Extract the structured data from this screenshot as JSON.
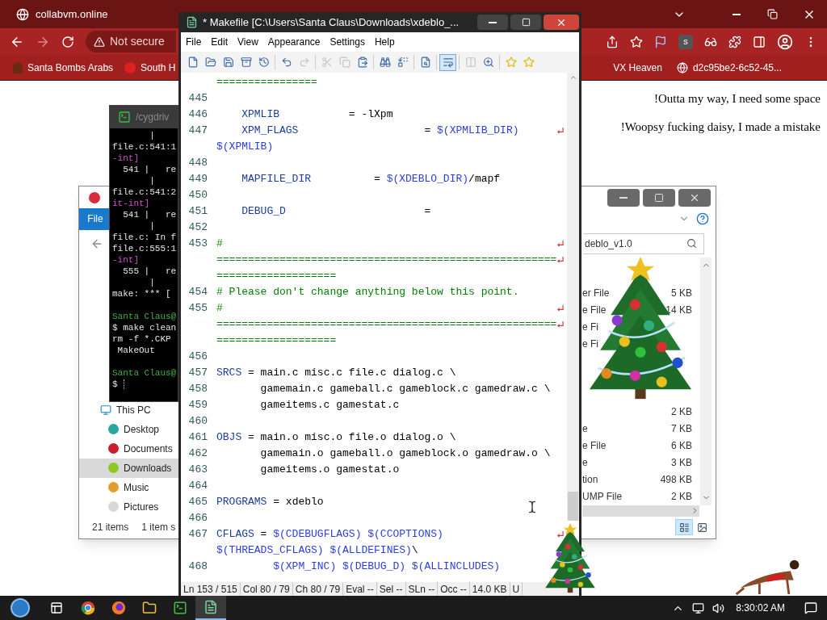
{
  "browser": {
    "tab_title": "collabvm.online",
    "security_label": "Not secure",
    "extension_letter": "s",
    "bookmarks_left": [
      {
        "label": "Santa Bombs Arabs"
      },
      {
        "label": "South H"
      }
    ],
    "bookmarks_right": [
      {
        "label": "VX Heaven"
      },
      {
        "label": "d2c95be2-6c52-45..."
      }
    ]
  },
  "chat": [
    "!Outta my way, I need some space",
    "!Woopsy fucking daisy, I made a mistake"
  ],
  "terminal": {
    "title": "/cygdriv",
    "lines": [
      {
        "kind": "plain",
        "text": "       |"
      },
      {
        "kind": "plain",
        "text": "file.c:541:1"
      },
      {
        "kind": "warn",
        "text": "-int]"
      },
      {
        "kind": "plain",
        "text": "  541 |   re"
      },
      {
        "kind": "plain",
        "text": "       |"
      },
      {
        "kind": "plain",
        "text": "file.c:541:2"
      },
      {
        "kind": "warn",
        "text": "it-int]"
      },
      {
        "kind": "plain",
        "text": "  541 |   re"
      },
      {
        "kind": "plain",
        "text": "       |"
      },
      {
        "kind": "plain",
        "text": "file.c: In f"
      },
      {
        "kind": "plain",
        "text": "file.c:555:1"
      },
      {
        "kind": "warn",
        "text": "-int]"
      },
      {
        "kind": "plain",
        "text": "  555 |   re"
      },
      {
        "kind": "plain",
        "text": "       |"
      },
      {
        "kind": "plain",
        "text": "make: *** ["
      },
      {
        "kind": "blank"
      },
      {
        "kind": "prompt",
        "text": "Santa Claus@"
      },
      {
        "kind": "plain",
        "text": "$ make clean"
      },
      {
        "kind": "plain",
        "text": "rm -f *.CKP"
      },
      {
        "kind": "plain",
        "text": " MakeOut"
      },
      {
        "kind": "blank"
      },
      {
        "kind": "prompt",
        "text": "Santa Claus@"
      },
      {
        "kind": "input",
        "text": "$"
      }
    ]
  },
  "explorer": {
    "ribbon_tab": "File",
    "search_value": "deblo_v1.0",
    "nav": [
      {
        "label": "This PC",
        "selected": false,
        "children": [
          {
            "label": "Desktop",
            "selected": false,
            "color": "#2aa6a0"
          },
          {
            "label": "Documents",
            "selected": false,
            "color": "#c8202a"
          },
          {
            "label": "Downloads",
            "selected": true,
            "color": "#8cc820"
          },
          {
            "label": "Music",
            "selected": false,
            "color": "#e0a030"
          },
          {
            "label": "Pictures",
            "selected": false,
            "color": "#d8d8d8"
          }
        ]
      }
    ],
    "files_upper": [
      {
        "type": "er File",
        "size": "5 KB"
      },
      {
        "type": "e File",
        "size": "14 KB"
      },
      {
        "type": "e Fi"
      },
      {
        "type": "e Fi"
      }
    ],
    "files_lower": [
      {
        "size": "2 KB"
      },
      {
        "type": "e",
        "size": "7 KB"
      },
      {
        "type": "e File",
        "size": "6 KB"
      },
      {
        "type": "e",
        "size": "3 KB"
      },
      {
        "type": "tion",
        "size": "498 KB"
      },
      {
        "type": "UMP File",
        "size": "2 KB"
      }
    ],
    "status_count": "21 items",
    "status_selection": "1 item s",
    "details_view": true
  },
  "editor": {
    "title": "* Makefile [C:\\Users\\Santa Claus\\Downloads\\xdeblo_...",
    "menu": [
      "File",
      "Edit",
      "View",
      "Appearance",
      "Settings",
      "Help"
    ],
    "toolbar": [
      {
        "disabled": false,
        "selected": false
      },
      {
        "disabled": false,
        "selected": false
      },
      {
        "disabled": false,
        "selected": false
      },
      {
        "disabled": false,
        "selected": false
      },
      {
        "disabled": false,
        "selected": false
      },
      {
        "disabled": false,
        "selected": false
      },
      {
        "disabled": true,
        "selected": false
      },
      {
        "disabled": true,
        "selected": false
      },
      {
        "disabled": true,
        "selected": false
      },
      {
        "disabled": false,
        "selected": false
      },
      {
        "disabled": false,
        "selected": false
      },
      {
        "disabled": false,
        "selected": false
      },
      {
        "disabled": false,
        "selected": false
      },
      {
        "disabled": false,
        "selected": true
      },
      {
        "disabled": true,
        "selected": false
      },
      {
        "disabled": false,
        "selected": false
      },
      {
        "disabled": false,
        "selected": false
      },
      {
        "disabled": false,
        "selected": false
      }
    ],
    "rows": [
      {
        "wrap": false,
        "seg": [
          {
            "text": "================",
            "kind": "comment"
          }
        ]
      },
      {
        "n": "445",
        "wrap": false
      },
      {
        "n": "446",
        "wrap": false,
        "seg": [
          {
            "text": "    XPMLIB",
            "kind": "name"
          },
          {
            "text": "           = -lXpm",
            "kind": "plain"
          }
        ]
      },
      {
        "n": "447",
        "wrap": true,
        "seg": [
          {
            "text": "    XPM_FLAGS",
            "kind": "name"
          },
          {
            "text": "                    = ",
            "kind": "plain"
          },
          {
            "text": "$(XPMLIB_DIR)",
            "kind": "macro"
          }
        ]
      },
      {
        "wrap": false,
        "seg": [
          {
            "text": "$(XPMLIB)",
            "kind": "macro"
          }
        ]
      },
      {
        "n": "448",
        "wrap": false
      },
      {
        "n": "449",
        "wrap": false,
        "seg": [
          {
            "text": "    MAPFILE_DIR",
            "kind": "name"
          },
          {
            "text": "          = ",
            "kind": "plain"
          },
          {
            "text": "$(XDEBLO_DIR)",
            "kind": "macro"
          },
          {
            "text": "/mapf",
            "kind": "plain"
          }
        ]
      },
      {
        "n": "450",
        "wrap": false
      },
      {
        "n": "451",
        "wrap": false,
        "seg": [
          {
            "text": "    DEBUG_D",
            "kind": "name"
          },
          {
            "text": "                      =",
            "kind": "plain"
          }
        ]
      },
      {
        "n": "452",
        "wrap": false
      },
      {
        "n": "453",
        "wrap": true,
        "seg": [
          {
            "text": "#",
            "kind": "comment"
          }
        ]
      },
      {
        "wrap": true,
        "seg": [
          {
            "text": "======================================================",
            "kind": "comment"
          }
        ]
      },
      {
        "wrap": false,
        "seg": [
          {
            "text": "===================",
            "kind": "comment"
          }
        ]
      },
      {
        "n": "454",
        "wrap": false,
        "seg": [
          {
            "text": "# Please don't change anything below this point.",
            "kind": "comment"
          }
        ]
      },
      {
        "n": "455",
        "wrap": true,
        "seg": [
          {
            "text": "#",
            "kind": "comment"
          }
        ]
      },
      {
        "wrap": true,
        "seg": [
          {
            "text": "======================================================",
            "kind": "comment"
          }
        ]
      },
      {
        "wrap": false,
        "seg": [
          {
            "text": "===================",
            "kind": "comment"
          }
        ]
      },
      {
        "n": "456",
        "wrap": false
      },
      {
        "n": "457",
        "wrap": false,
        "seg": [
          {
            "text": "SRCS",
            "kind": "name"
          },
          {
            "text": " = main.c misc.c file.c dialog.c \\",
            "kind": "plain"
          }
        ]
      },
      {
        "n": "458",
        "wrap": false,
        "seg": [
          {
            "text": "       gamemain.c gameball.c gameblock.c gamedraw.c \\",
            "kind": "plain"
          }
        ]
      },
      {
        "n": "459",
        "wrap": false,
        "seg": [
          {
            "text": "       gameitems.c gamestat.c",
            "kind": "plain"
          }
        ]
      },
      {
        "n": "460",
        "wrap": false
      },
      {
        "n": "461",
        "wrap": false,
        "seg": [
          {
            "text": "OBJS",
            "kind": "name"
          },
          {
            "text": " = main.o misc.o file.o dialog.o \\",
            "kind": "plain"
          }
        ]
      },
      {
        "n": "462",
        "wrap": false,
        "seg": [
          {
            "text": "       gamemain.o gameball.o gameblock.o gamedraw.o \\",
            "kind": "plain"
          }
        ]
      },
      {
        "n": "463",
        "wrap": false,
        "seg": [
          {
            "text": "       gameitems.o gamestat.o",
            "kind": "plain"
          }
        ]
      },
      {
        "n": "464",
        "wrap": false
      },
      {
        "n": "465",
        "wrap": false,
        "seg": [
          {
            "text": "PROGRAMS",
            "kind": "name"
          },
          {
            "text": " = xdeblo",
            "kind": "plain"
          }
        ]
      },
      {
        "n": "466",
        "wrap": false
      },
      {
        "n": "467",
        "wrap": true,
        "seg": [
          {
            "text": "CFLAGS",
            "kind": "name"
          },
          {
            "text": " = ",
            "kind": "plain"
          },
          {
            "text": "$(CDEBUGFLAGS) $(CCOPTIONS)",
            "kind": "macro"
          }
        ]
      },
      {
        "wrap": false,
        "seg": [
          {
            "text": "$(THREADS_CFLAGS) $(ALLDEFINES)",
            "kind": "macro"
          },
          {
            "text": "\\",
            "kind": "plain"
          }
        ]
      },
      {
        "n": "468",
        "wrap": false,
        "seg": [
          {
            "text": "         $(XPM_INC) $(DEBUG_D) $(ALLINCLUDES)",
            "kind": "macro"
          }
        ]
      }
    ],
    "status": [
      "Ln 153 / 515",
      "Col 80 / 79",
      "Ch 80 / 79",
      "Eval --",
      "Sel --",
      "SLn --",
      "Occ --",
      "14.0 KB",
      "U"
    ]
  },
  "taskbar": {
    "time": "8:30:02 AM"
  }
}
